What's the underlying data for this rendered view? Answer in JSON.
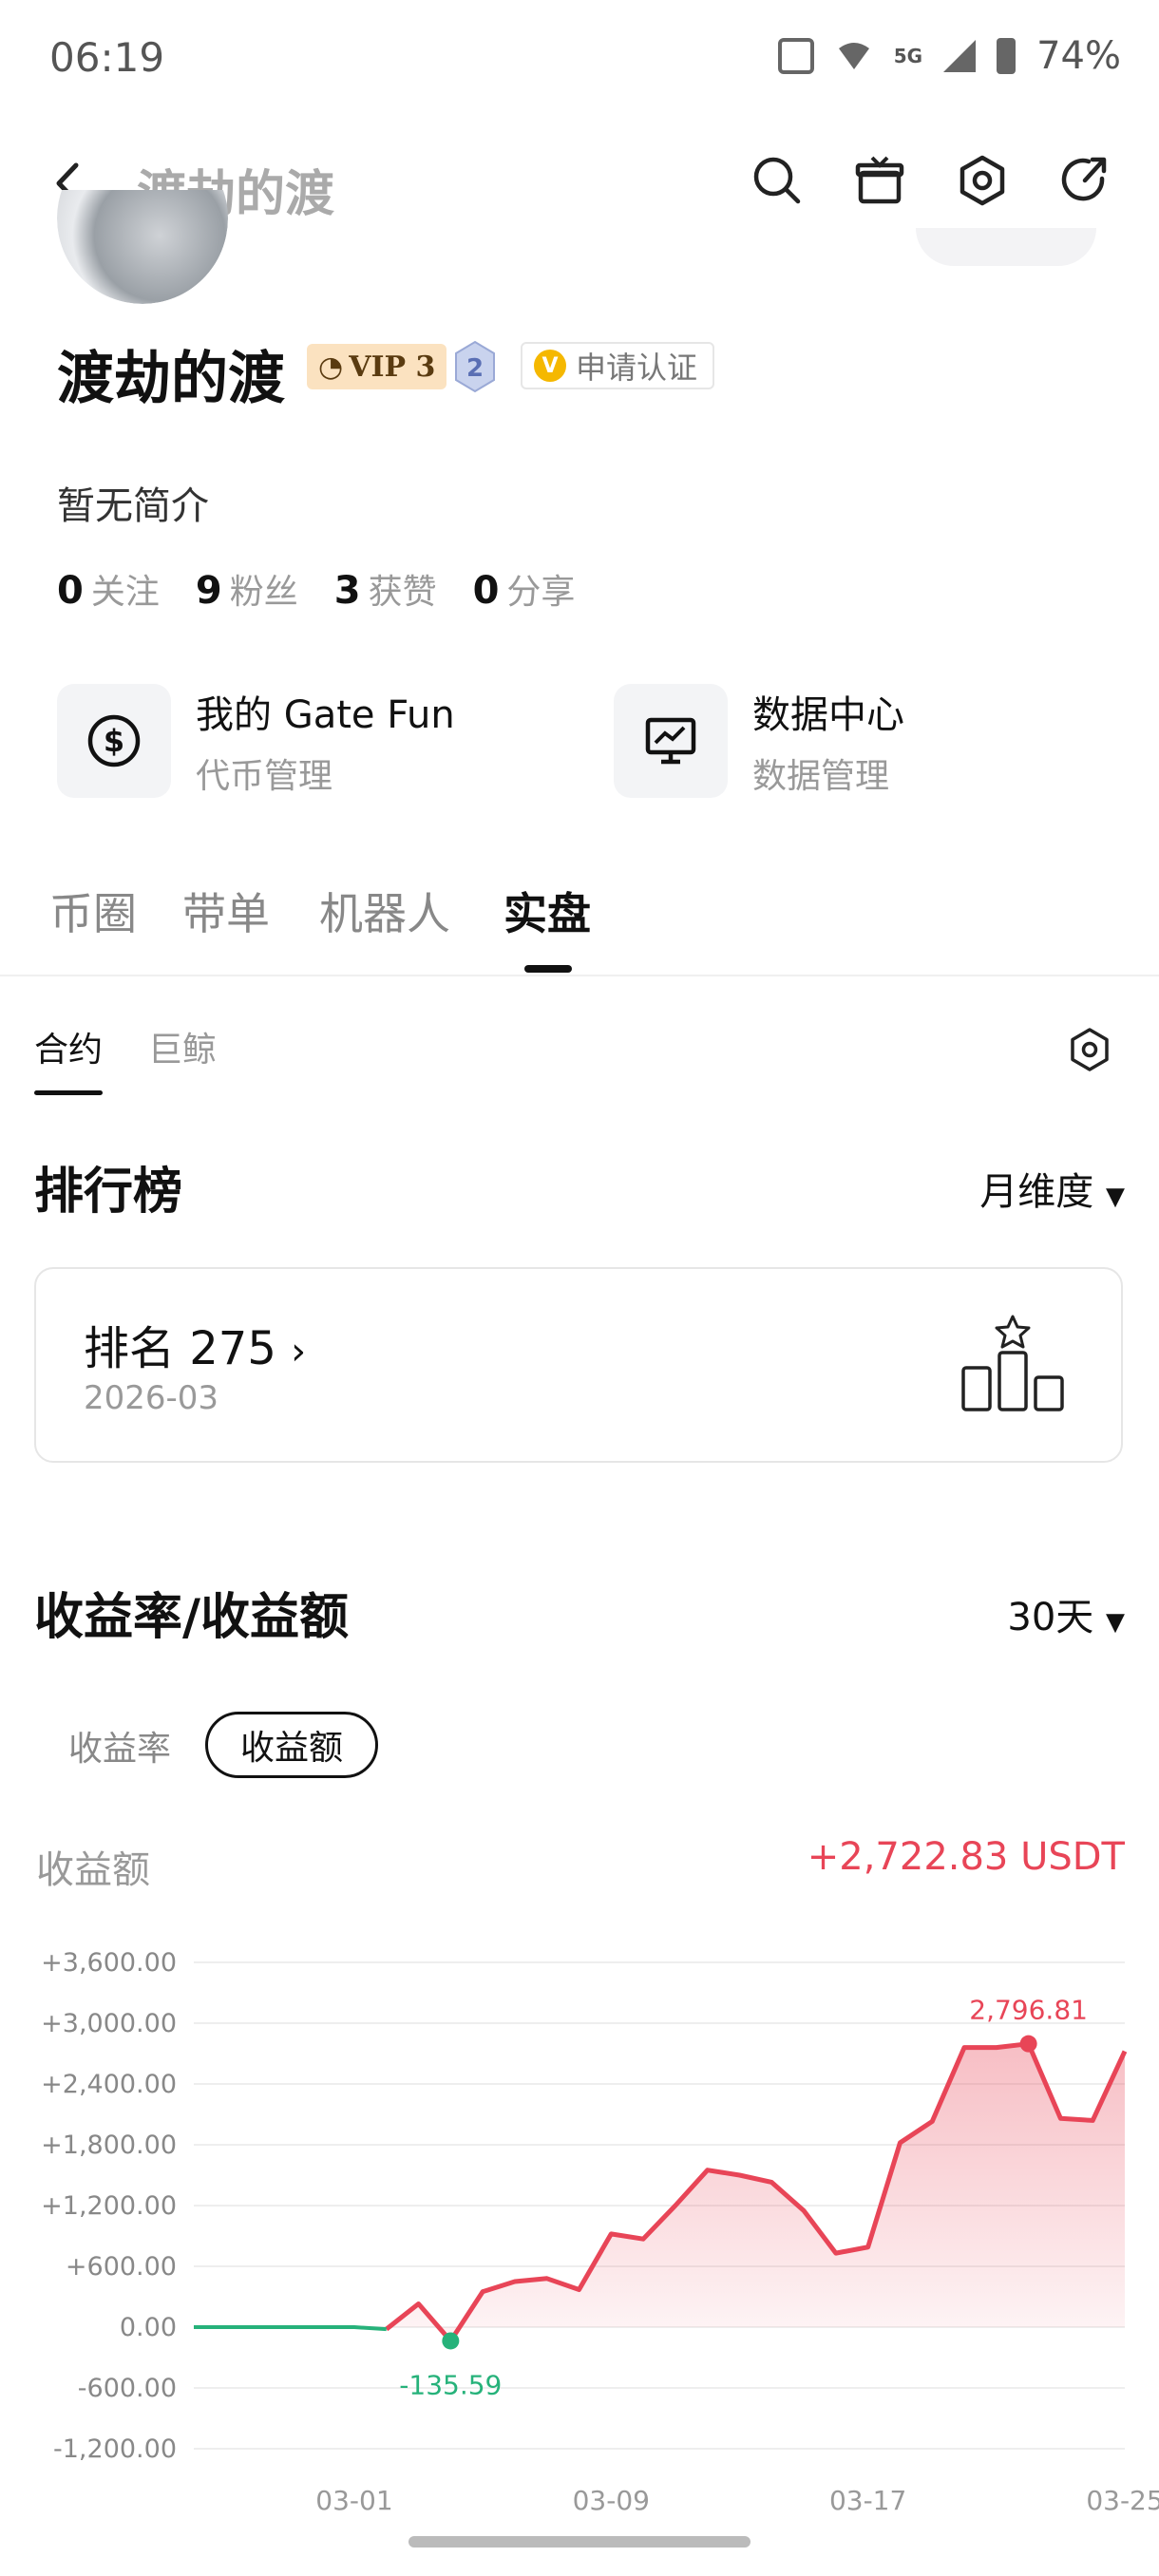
{
  "status_bar": {
    "time": "06:19",
    "battery": "74%",
    "network": "5G"
  },
  "header": {
    "title": "渡劫的渡"
  },
  "profile": {
    "username": "渡劫的渡",
    "vip": "VIP 3",
    "level": "2",
    "verify_label": "申请认证",
    "bio": "暂无简介",
    "stats": [
      {
        "num": "0",
        "label": "关注"
      },
      {
        "num": "9",
        "label": "粉丝"
      },
      {
        "num": "3",
        "label": "获赞"
      },
      {
        "num": "0",
        "label": "分享"
      }
    ]
  },
  "cards": [
    {
      "title": "我的 Gate Fun",
      "subtitle": "代币管理",
      "icon": "dollar-circle-icon"
    },
    {
      "title": "数据中心",
      "subtitle": "数据管理",
      "icon": "monitor-chart-icon"
    }
  ],
  "main_tabs": [
    "币圈",
    "带单",
    "机器人",
    "实盘"
  ],
  "sub_tabs": [
    "合约",
    "巨鲸"
  ],
  "leaderboard": {
    "title": "排行榜",
    "period": "月维度",
    "rank_label": "排名 275",
    "rank_date": "2026-03"
  },
  "profit": {
    "title": "收益率/收益额",
    "range": "30天",
    "toggle_inactive": "收益率",
    "toggle_active": "收益额",
    "label": "收益额",
    "total": "+2,722.83 USDT"
  },
  "chart_data": {
    "type": "area",
    "x": [
      "02-24",
      "02-25",
      "02-26",
      "02-27",
      "02-28",
      "03-01",
      "03-02",
      "03-03",
      "03-04",
      "03-05",
      "03-06",
      "03-07",
      "03-08",
      "03-09",
      "03-10",
      "03-11",
      "03-12",
      "03-13",
      "03-14",
      "03-15",
      "03-16",
      "03-17",
      "03-18",
      "03-19",
      "03-20",
      "03-21",
      "03-22",
      "03-23",
      "03-24",
      "03-25",
      "03-26"
    ],
    "y": [
      0,
      0,
      0,
      0,
      0,
      0,
      -20,
      230,
      -135.59,
      350,
      450,
      480,
      370,
      920,
      870,
      1200,
      1550,
      1500,
      1430,
      1150,
      730,
      790,
      1820,
      2030,
      2760,
      2760,
      2796.81,
      2060,
      2040,
      2722.83
    ],
    "ylim": [
      -1200,
      3600
    ],
    "y_ticks": [
      "+3,600.00",
      "+3,000.00",
      "+2,400.00",
      "+1,800.00",
      "+1,200.00",
      "+600.00",
      "0.00",
      "-600.00",
      "-1,200.00"
    ],
    "y_tick_values": [
      3600,
      3000,
      2400,
      1800,
      1200,
      600,
      0,
      -600,
      -1200
    ],
    "x_ticks": [
      "03-01",
      "03-09",
      "03-17",
      "03-25"
    ],
    "max_label": "2,796.81",
    "min_label": "-135.59",
    "colors": {
      "line": "#e84557",
      "fill": "#f8c6cc",
      "negative": "#26b27a",
      "grid": "#eeeeee"
    }
  }
}
